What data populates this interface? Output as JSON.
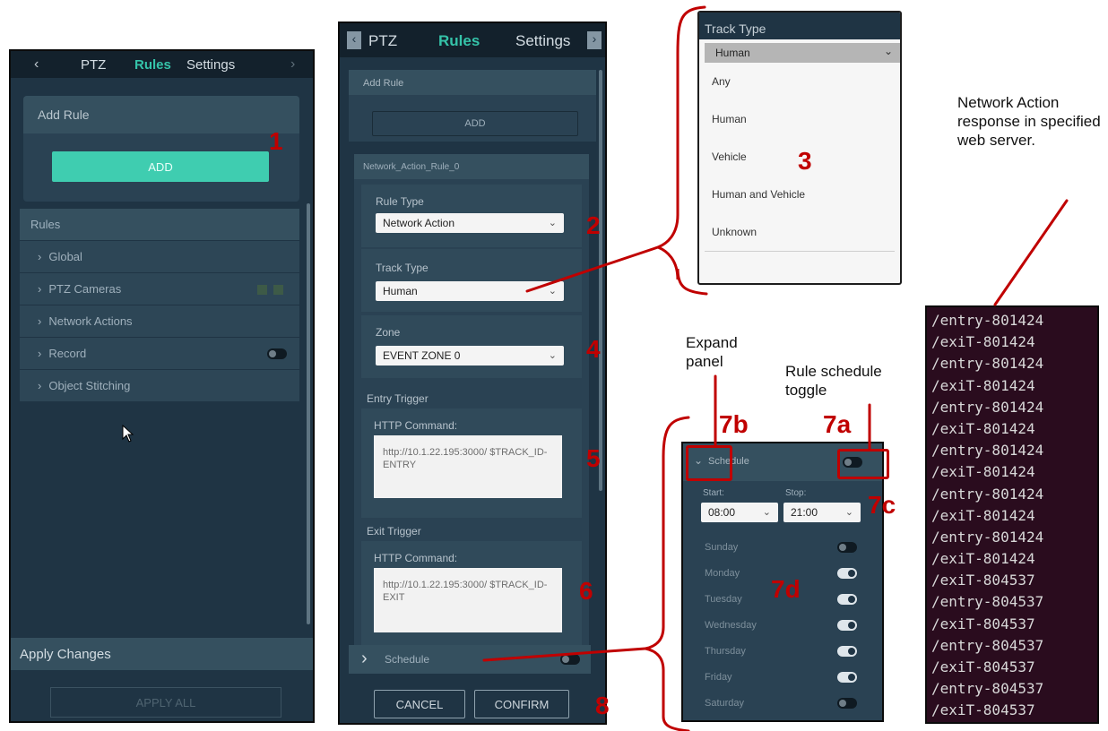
{
  "panel1": {
    "tabs": {
      "prev": "‹",
      "ptz": "PTZ",
      "rules": "Rules",
      "settings": "Settings",
      "next": "›"
    },
    "add_rule": {
      "title": "Add Rule",
      "button": "ADD"
    },
    "rules": {
      "header": "Rules",
      "items": [
        {
          "label": "Global"
        },
        {
          "label": "PTZ Cameras"
        },
        {
          "label": "Network Actions"
        },
        {
          "label": "Record",
          "toggle": false
        },
        {
          "label": "Object Stitching"
        }
      ]
    },
    "apply": {
      "title": "Apply Changes",
      "button": "APPLY ALL"
    }
  },
  "panel2": {
    "tabs": {
      "prev": "‹",
      "ptz": "PTZ",
      "rules": "Rules",
      "settings": "Settings",
      "next": "›"
    },
    "add_rule": {
      "title": "Add Rule",
      "button": "ADD"
    },
    "rule_name": "Network_Action_Rule_0",
    "rule_type": {
      "label": "Rule Type",
      "value": "Network Action"
    },
    "track_type": {
      "label": "Track Type",
      "value": "Human"
    },
    "zone": {
      "label": "Zone",
      "value": "EVENT ZONE 0"
    },
    "entry": {
      "title": "Entry Trigger",
      "label": "HTTP Command:",
      "value": "http://10.1.22.195:3000/ $TRACK_ID-ENTRY"
    },
    "exit": {
      "title": "Exit Trigger",
      "label": "HTTP Command:",
      "value": "http://10.1.22.195:3000/ $TRACK_ID-EXIT"
    },
    "schedule": {
      "label": "Schedule",
      "toggle": false
    },
    "cancel": "CANCEL",
    "confirm": "CONFIRM"
  },
  "track_dropdown": {
    "label": "Track Type",
    "selected": "Human",
    "options": [
      "Any",
      "Human",
      "Vehicle",
      "Human and Vehicle",
      "Unknown"
    ]
  },
  "schedule_panel": {
    "title": "Schedule",
    "start_label": "Start:",
    "start_value": "08:00",
    "stop_label": "Stop:",
    "stop_value": "21:00",
    "days": [
      {
        "name": "Sunday",
        "on": false
      },
      {
        "name": "Monday",
        "on": true
      },
      {
        "name": "Tuesday",
        "on": true
      },
      {
        "name": "Wednesday",
        "on": true
      },
      {
        "name": "Thursday",
        "on": true
      },
      {
        "name": "Friday",
        "on": true
      },
      {
        "name": "Saturday",
        "on": false
      }
    ]
  },
  "annotations": {
    "n1": "1",
    "n2": "2",
    "n3": "3",
    "n4": "4",
    "n5": "5",
    "n6": "6",
    "n7a": "7a",
    "n7b": "7b",
    "n7c": "7c",
    "n7d": "7d",
    "n8": "8",
    "expand_panel": "Expand panel",
    "rule_schedule_toggle": "Rule schedule toggle",
    "network_action_note": "Network Action response in specified web server."
  },
  "terminal": {
    "lines": [
      "/entry-801424",
      "/exiT-801424",
      "/entry-801424",
      "/exiT-801424",
      "/entry-801424",
      "/exiT-801424",
      "/entry-801424",
      "/exiT-801424",
      "/entry-801424",
      "/exiT-801424",
      "/entry-801424",
      "/exiT-801424",
      "/exiT-804537",
      "/entry-804537",
      "/exiT-804537",
      "/entry-804537",
      "/exiT-804537",
      "/entry-804537",
      "/exiT-804537"
    ]
  },
  "colors": {
    "accent": "#35c3a9",
    "annotation": "#c00000",
    "panel": "#1f3444",
    "terminal": "#2a0c1e"
  }
}
